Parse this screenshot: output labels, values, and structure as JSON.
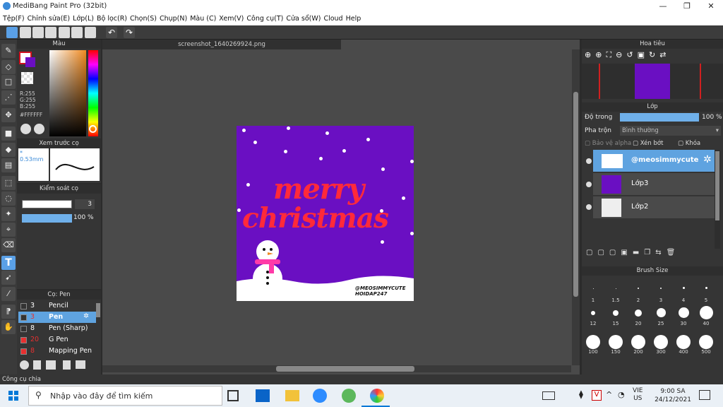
{
  "window": {
    "title": "MediBang Paint Pro (32bit)",
    "min": "—",
    "max": "❐",
    "close": "✕"
  },
  "menu": [
    "Tệp(F)",
    "Chỉnh sửa(E)",
    "Lớp(L)",
    "Bộ lọc(R)",
    "Chọn(S)",
    "Chụp(N)",
    "Màu (C)",
    "Xem(V)",
    "Công cụ(T)",
    "Cửa sổ(W)",
    "Cloud",
    "Help"
  ],
  "canvas": {
    "tab": "screenshot_1640269924.png"
  },
  "artwork": {
    "line1": "merry",
    "line2": "christmas",
    "credit1": "@MEOSIMMYCUTE",
    "credit2": "HOIDAP247"
  },
  "color_panel": {
    "title": "Màu",
    "r": "R:255",
    "g": "G:255",
    "b": "B:255",
    "hex": "#FFFFFF"
  },
  "brush_preview": {
    "title": "Xem trước cọ",
    "size": "* 0.53mm"
  },
  "brush_control": {
    "title": "Kiểm soát cọ",
    "size_value": "3",
    "opacity_value": "100 %"
  },
  "brush_list": {
    "title": "Cọ: Pen",
    "items": [
      {
        "size": "3",
        "name": "Pencil",
        "color": "#333333"
      },
      {
        "size": "3",
        "name": "Pen",
        "color": "#333333",
        "selected": true
      },
      {
        "size": "8",
        "name": "Pen (Sharp)",
        "color": "#333333"
      },
      {
        "size": "20",
        "name": "G Pen",
        "color": "#e83030"
      },
      {
        "size": "8",
        "name": "Mapping Pen",
        "color": "#e83030"
      }
    ]
  },
  "navigator": {
    "title": "Hoa tiêu"
  },
  "layers": {
    "title": "Lớp",
    "opacity_label": "Độ trong",
    "opacity_value": "100 %",
    "blend_label": "Pha trộn",
    "blend_value": "Bình thường",
    "alpha": "Bảo vệ alpha",
    "clip": "Xén bớt",
    "lock": "Khóa",
    "items": [
      {
        "name": "@meosimmycute",
        "selected": true
      },
      {
        "name": "Lớp3"
      },
      {
        "name": "Lớp2"
      }
    ]
  },
  "brush_size": {
    "title": "Brush Size",
    "sizes": [
      "1",
      "1.5",
      "2",
      "3",
      "4",
      "5",
      "12",
      "15",
      "20",
      "25",
      "30",
      "40",
      "100",
      "150",
      "200",
      "300",
      "400",
      "500"
    ]
  },
  "status": {
    "text": "Công cụ chia"
  },
  "taskbar": {
    "search": "Nhập vào đây để tìm kiếm",
    "lang1": "VIE",
    "lang2": "US",
    "time": "9:00 SA",
    "date": "24/12/2021"
  }
}
